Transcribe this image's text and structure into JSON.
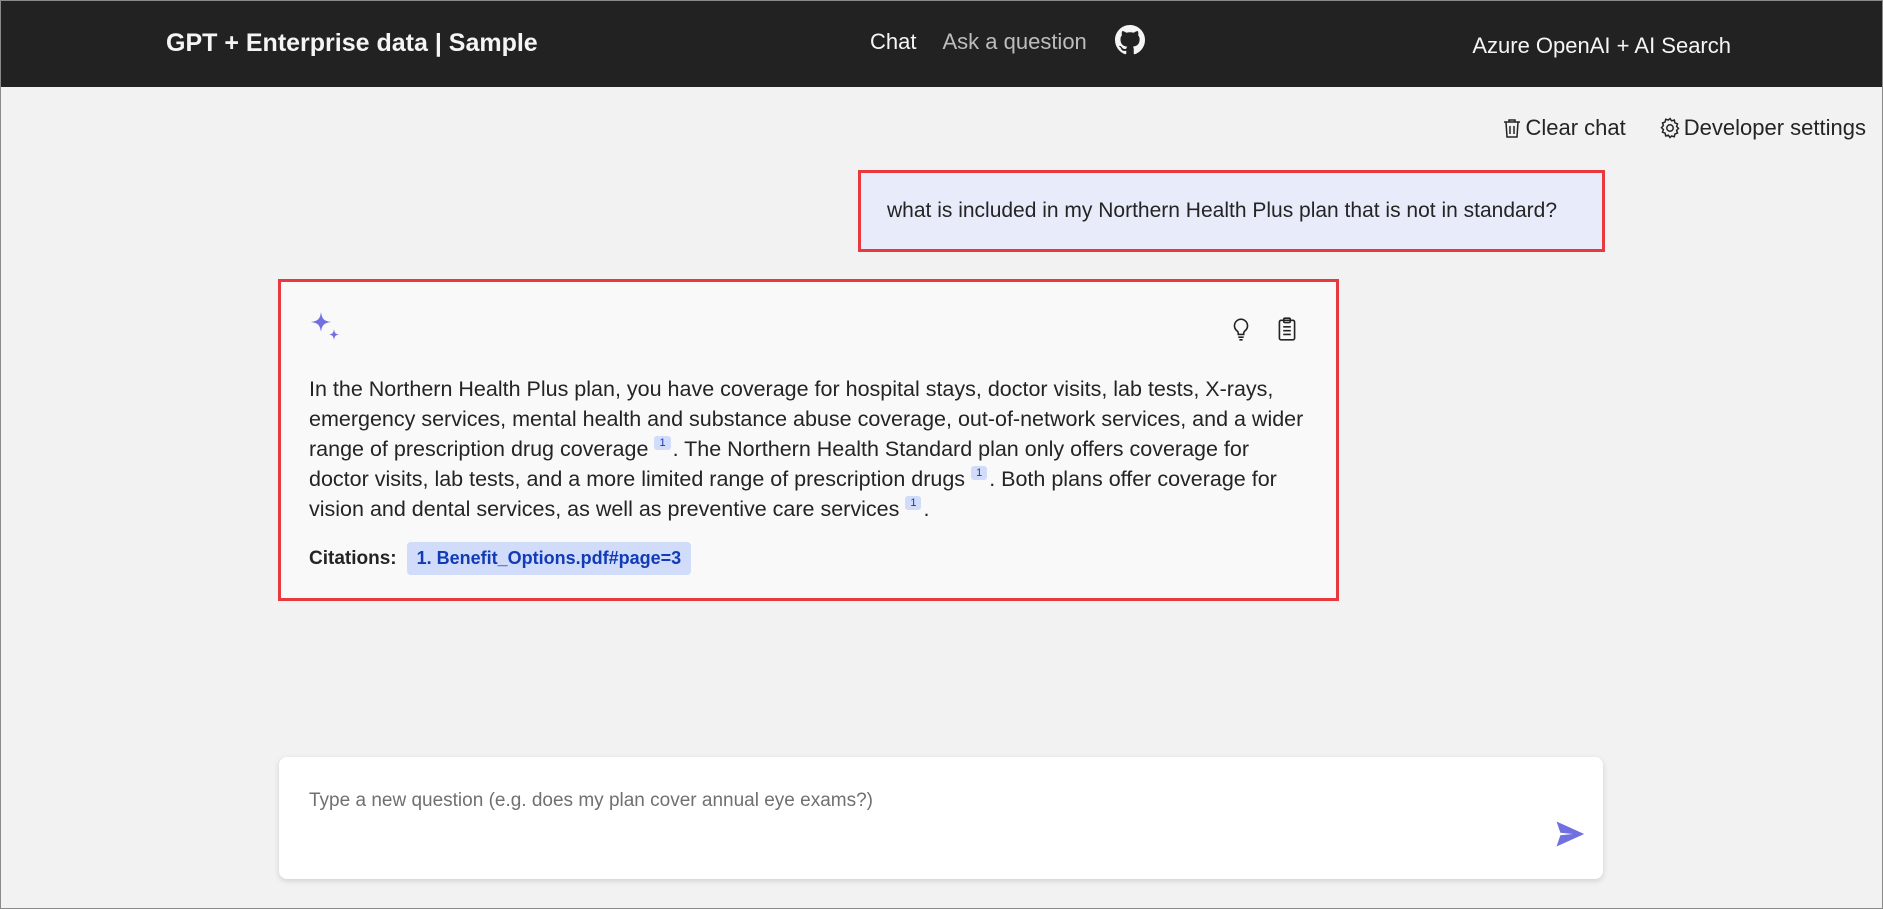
{
  "header": {
    "brand": "GPT + Enterprise data | Sample",
    "nav": {
      "chat": "Chat",
      "ask": "Ask a question"
    },
    "right_title": "Azure OpenAI + AI Search"
  },
  "toolbar": {
    "clear_chat": "Clear chat",
    "developer_settings": "Developer settings"
  },
  "chat": {
    "user_message": "what is included in my Northern Health Plus plan that is not in standard?",
    "answer": {
      "seg1": "In the Northern Health Plus plan, you have coverage for hospital stays, doctor visits, lab tests, X-rays, emergency services, mental health and substance abuse coverage, out-of-network services, and a wider range of prescription drug coverage",
      "seg2": ". The Northern Health Standard plan only offers coverage for doctor visits, lab tests, and a more limited range of prescription drugs",
      "seg3": ". Both plans offer coverage for vision and dental services, as well as preventive care services",
      "seg4": ".",
      "ref": "1",
      "citations_label": "Citations:",
      "citation": "1. Benefit_Options.pdf#page=3"
    }
  },
  "input": {
    "placeholder": "Type a new question (e.g. does my plan cover annual eye exams?)",
    "value": ""
  },
  "colors": {
    "header_bg": "#222222",
    "accent": "#7070e0",
    "highlight_border": "#e8393f",
    "user_bubble": "#e8ebfa",
    "citation_bg": "#d1dbfa",
    "citation_text": "#123bb6"
  }
}
